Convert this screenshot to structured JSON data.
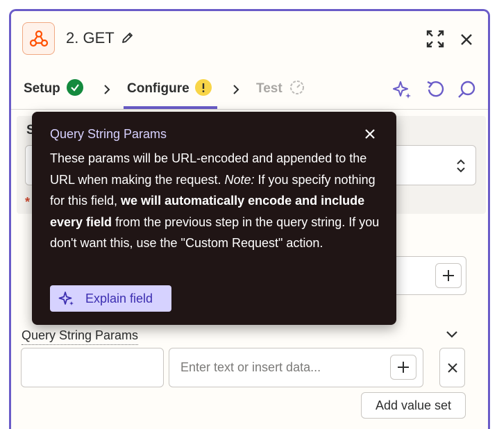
{
  "header": {
    "title": "2. GET",
    "app_icon": "webhook-icon",
    "brand_color": "#ff4f00"
  },
  "tabs": [
    {
      "label": "Setup",
      "status": "complete"
    },
    {
      "label": "Configure",
      "status": "warning"
    },
    {
      "label": "Test",
      "status": "pending"
    }
  ],
  "form": {
    "section_label": "S",
    "required_marker": "*",
    "query_params_label": "Query String Params",
    "value_placeholder": "Enter text or insert data...",
    "add_value_set_label": "Add value set"
  },
  "tooltip": {
    "title": "Query String Params",
    "text_1": "These params will be URL-encoded and appended to the URL when making the request. ",
    "note_label": "Note:",
    "text_2": " If you specify nothing for this field, ",
    "bold_text": "we will automatically encode and include every field",
    "text_3": " from the previous step in the query string. If you don't want this, use the \"Custom Request\" action.",
    "button_label": "Explain field"
  },
  "colors": {
    "accent": "#6a5cc8",
    "success": "#148a3e",
    "warning": "#f8d548",
    "tooltip_bg": "#201515"
  }
}
